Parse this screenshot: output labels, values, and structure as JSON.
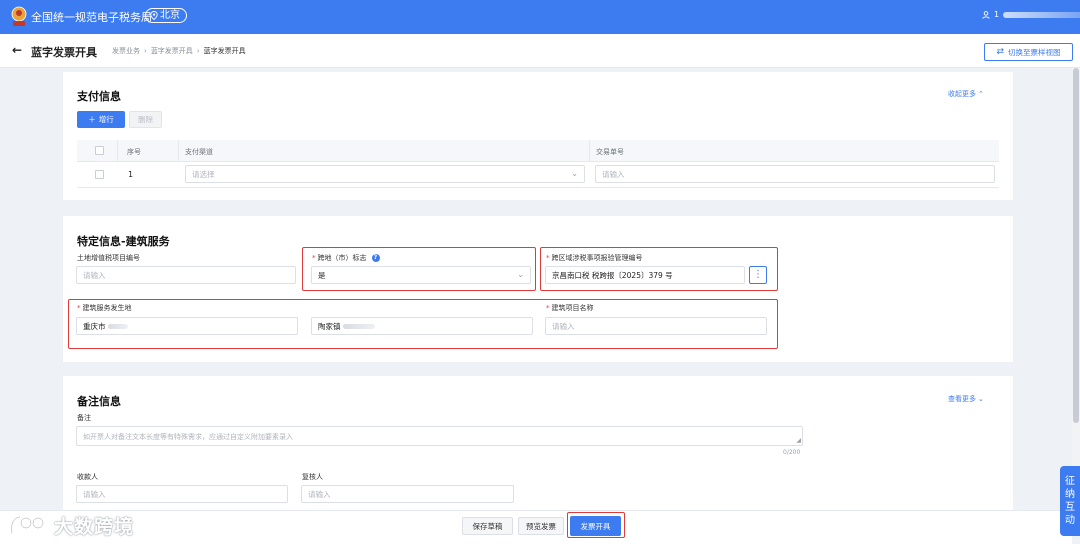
{
  "header": {
    "app_title": "全国统一规范电子税务局",
    "region": "北京",
    "user_prefix": "1",
    "colors": {
      "brand": "#3d7bf0",
      "required": "#e03a3a",
      "annotation": "#e03a3a"
    }
  },
  "subheader": {
    "page_title": "蓝字发票开具",
    "breadcrumb": [
      "发票业务",
      "蓝字发票开具",
      "蓝字发票开具"
    ],
    "switch_label": "切换至票样视图"
  },
  "payment": {
    "title": "支付信息",
    "collapse_label": "收起更多",
    "add_row_label": "增行",
    "delete_label": "删除",
    "columns": {
      "index": "序号",
      "channel": "支付渠道",
      "txn": "交易单号"
    },
    "rows": [
      {
        "index": "1",
        "channel_placeholder": "请选择",
        "txn_placeholder": "请输入"
      }
    ]
  },
  "special": {
    "title": "特定信息-建筑服务",
    "land_tax_label": "土地增值税项目编号",
    "land_tax_placeholder": "请输入",
    "cross_region_label": "跨地（市）标志",
    "cross_region_value": "是",
    "cross_region_mgmt_label": "跨区域涉税事项报验管理编号",
    "cross_region_mgmt_value": "京昌南口税 税跨报〔2025〕379 号",
    "service_location_label": "建筑服务发生地",
    "service_location_city": "重庆市",
    "service_location_detail": "陶家镇",
    "project_name_label": "建筑项目名称",
    "project_name_placeholder": "请输入"
  },
  "remark": {
    "title": "备注信息",
    "view_more_label": "查看更多",
    "remark_label": "备注",
    "remark_placeholder": "如开票人对备注文本长度等有特殊需求，应通过自定义附加要素录入",
    "counter": "0/200",
    "payee_label": "收款人",
    "payee_placeholder": "请输入",
    "reviewer_label": "复核人",
    "reviewer_placeholder": "请输入"
  },
  "footer": {
    "save_draft": "保存草稿",
    "preview": "预览发票",
    "issue": "发票开具"
  },
  "watermark": {
    "text": "大数跨境"
  },
  "side_panel": {
    "chars": [
      "征",
      "纳",
      "互",
      "动"
    ]
  }
}
